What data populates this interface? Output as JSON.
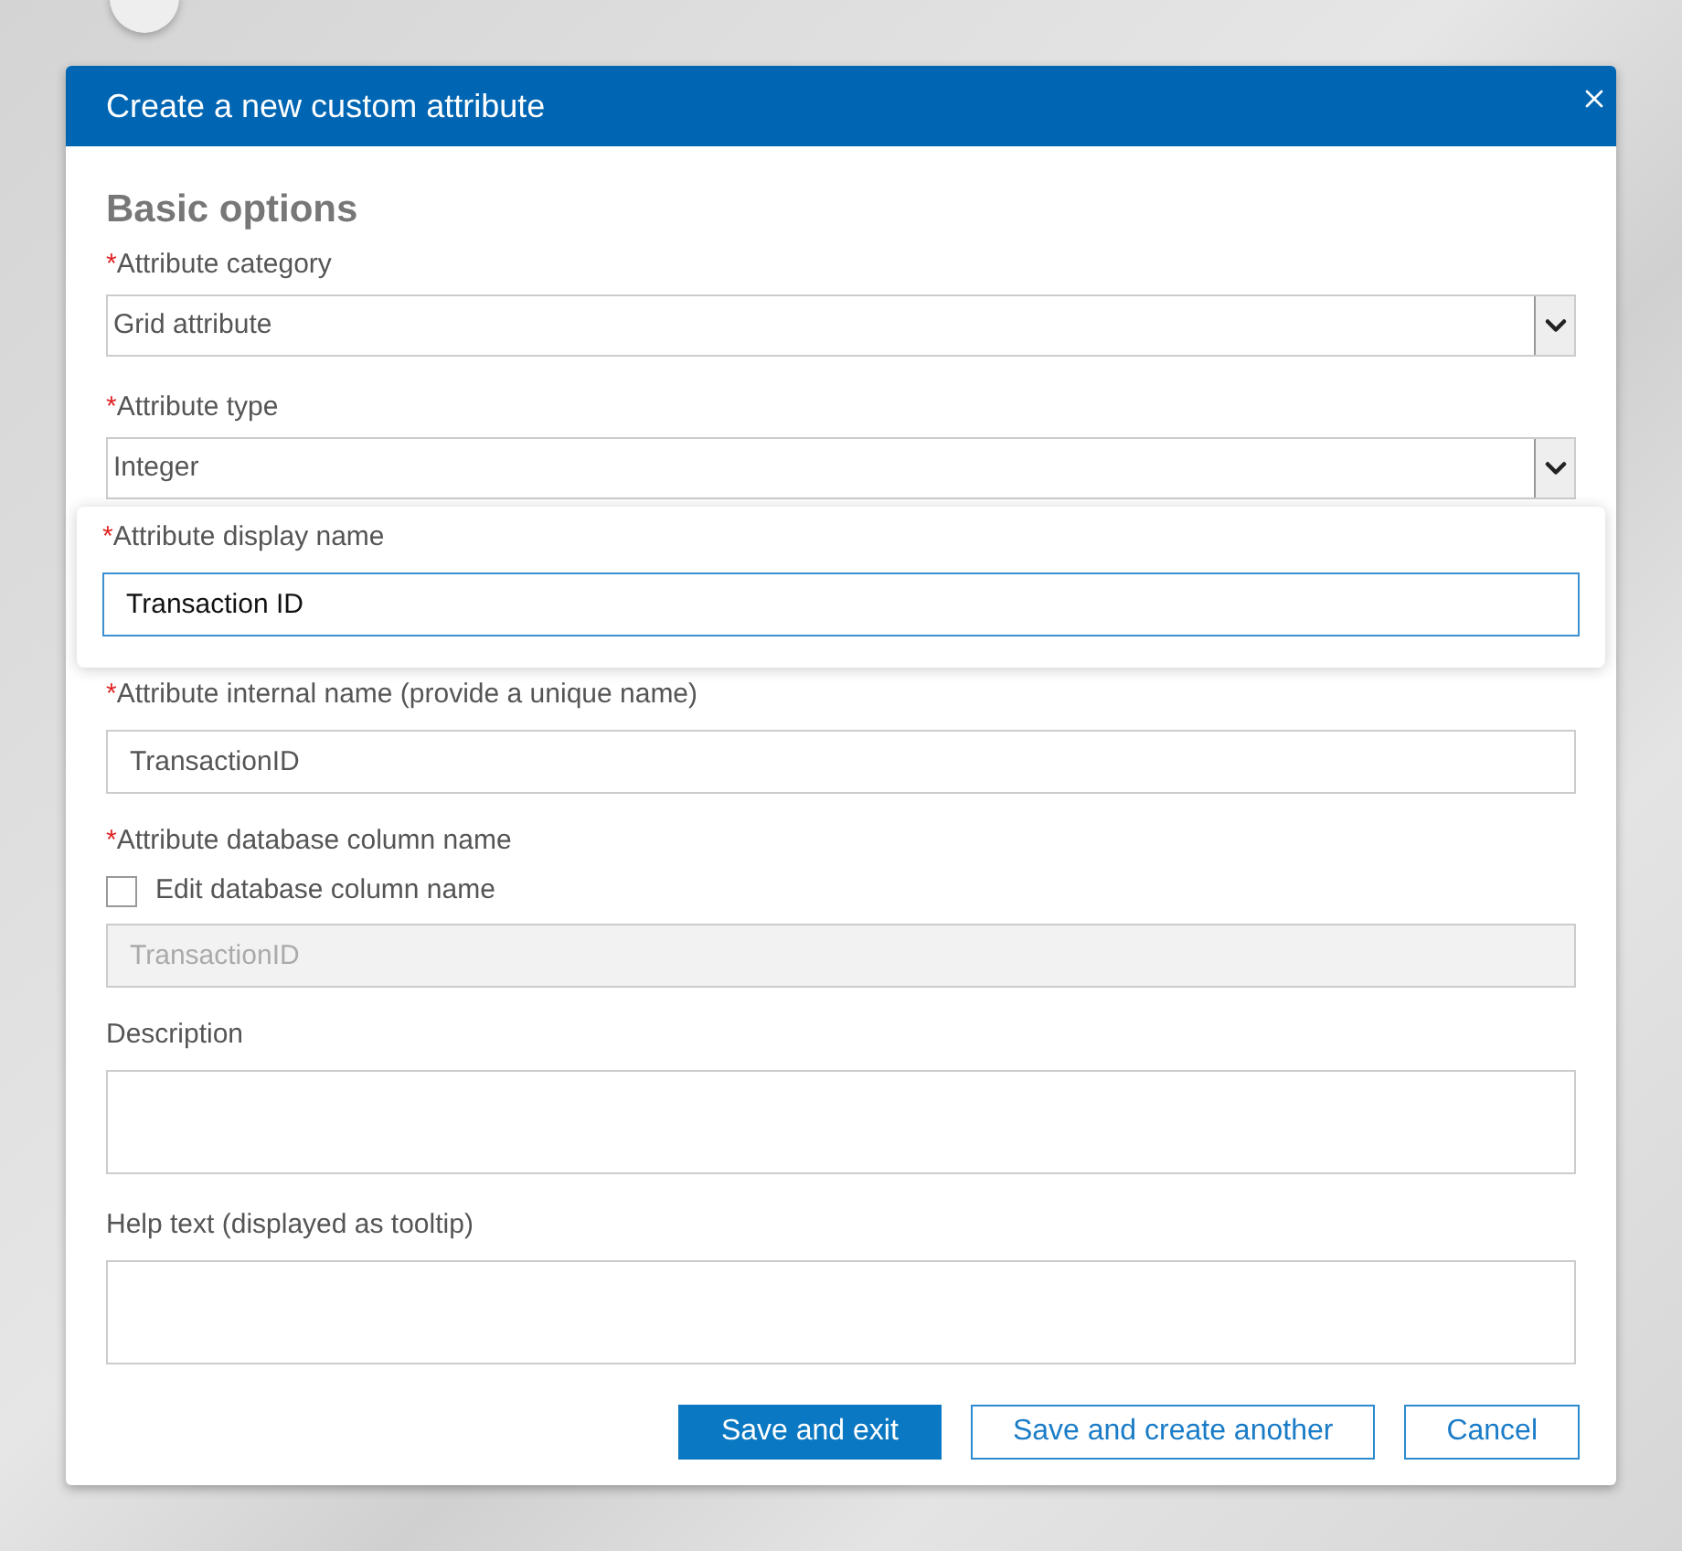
{
  "dialog": {
    "title": "Create a new custom attribute",
    "section_title": "Basic options"
  },
  "required_mark": "*",
  "fields": [
    {
      "kind": "select",
      "label": "Attribute category",
      "required": true,
      "value": "Grid attribute"
    },
    {
      "kind": "select",
      "label": "Attribute type",
      "required": true,
      "value": "Integer"
    },
    {
      "kind": "text",
      "label": "Attribute display name",
      "required": true,
      "value": "Transaction ID",
      "focused": true,
      "disabled": false
    },
    {
      "kind": "text",
      "label": "Attribute internal name (provide a unique name)",
      "required": true,
      "value": "TransactionID",
      "focused": false,
      "disabled": false
    },
    {
      "kind": "checkbox_text",
      "label": "Attribute database column name",
      "required": true,
      "checkbox": {
        "label": "Edit database column name",
        "checked": false
      }
    },
    {
      "kind": "text",
      "value": "TransactionID",
      "focused": false,
      "disabled": true
    },
    {
      "kind": "textarea",
      "label": "Description",
      "required": false
    },
    {
      "kind": "textarea",
      "label": "Help text (displayed as tooltip)",
      "required": false
    }
  ],
  "buttons": [
    {
      "label": "Save and exit",
      "primary": true
    },
    {
      "label": "Save and create another",
      "primary": false
    },
    {
      "label": "Cancel",
      "primary": false
    }
  ]
}
